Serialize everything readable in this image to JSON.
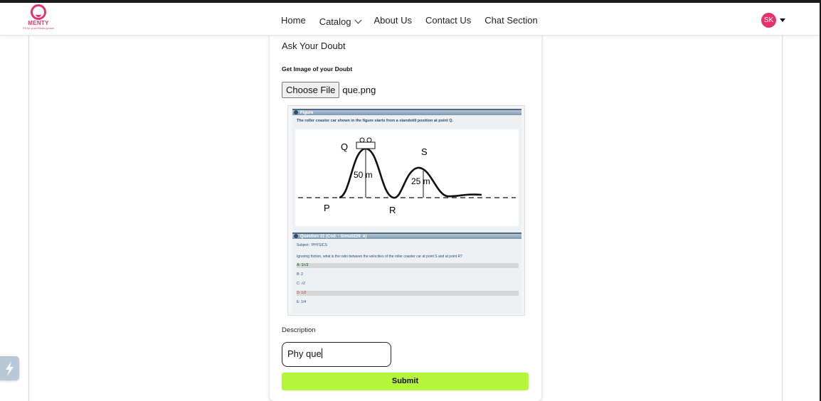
{
  "brand": {
    "name": "MENTY",
    "tagline": "Fit for your Mind's peace"
  },
  "nav": {
    "items": [
      {
        "label": "Home"
      },
      {
        "label": "Catalog"
      },
      {
        "label": "About Us"
      },
      {
        "label": "Contact Us"
      },
      {
        "label": "Chat Section"
      }
    ],
    "avatar_initials": "SK"
  },
  "form": {
    "title": "Ask Your Doubt",
    "image_label": "Get Image of your Doubt",
    "choose_file_label": "Choose File",
    "file_name": "que.png",
    "description_label": "Description",
    "description_value": "Phy que",
    "submit_label": "Submit"
  },
  "preview": {
    "figure_header": "Figure",
    "figure_caption": "The roller coaster car shown in the figure starts from a standstill position at point Q.",
    "labels": {
      "q": "Q",
      "s": "S",
      "p": "P",
      "r": "R",
      "h1": "50 m",
      "h2": "25 m"
    },
    "question_header": "Question 31 (Cod. : Simu0229_e)",
    "subject": "Subject : PHYSICS",
    "question": "Ignoring friction, what is the ratio between the velocities of the roller coaster car at point S and at point R?",
    "options": [
      "A: 1/√2",
      "B: 2",
      "C: √2",
      "D: 1/2",
      "E: 1/4"
    ]
  },
  "colors": {
    "brand": "#e8326f",
    "submit": "#b5f53a"
  }
}
